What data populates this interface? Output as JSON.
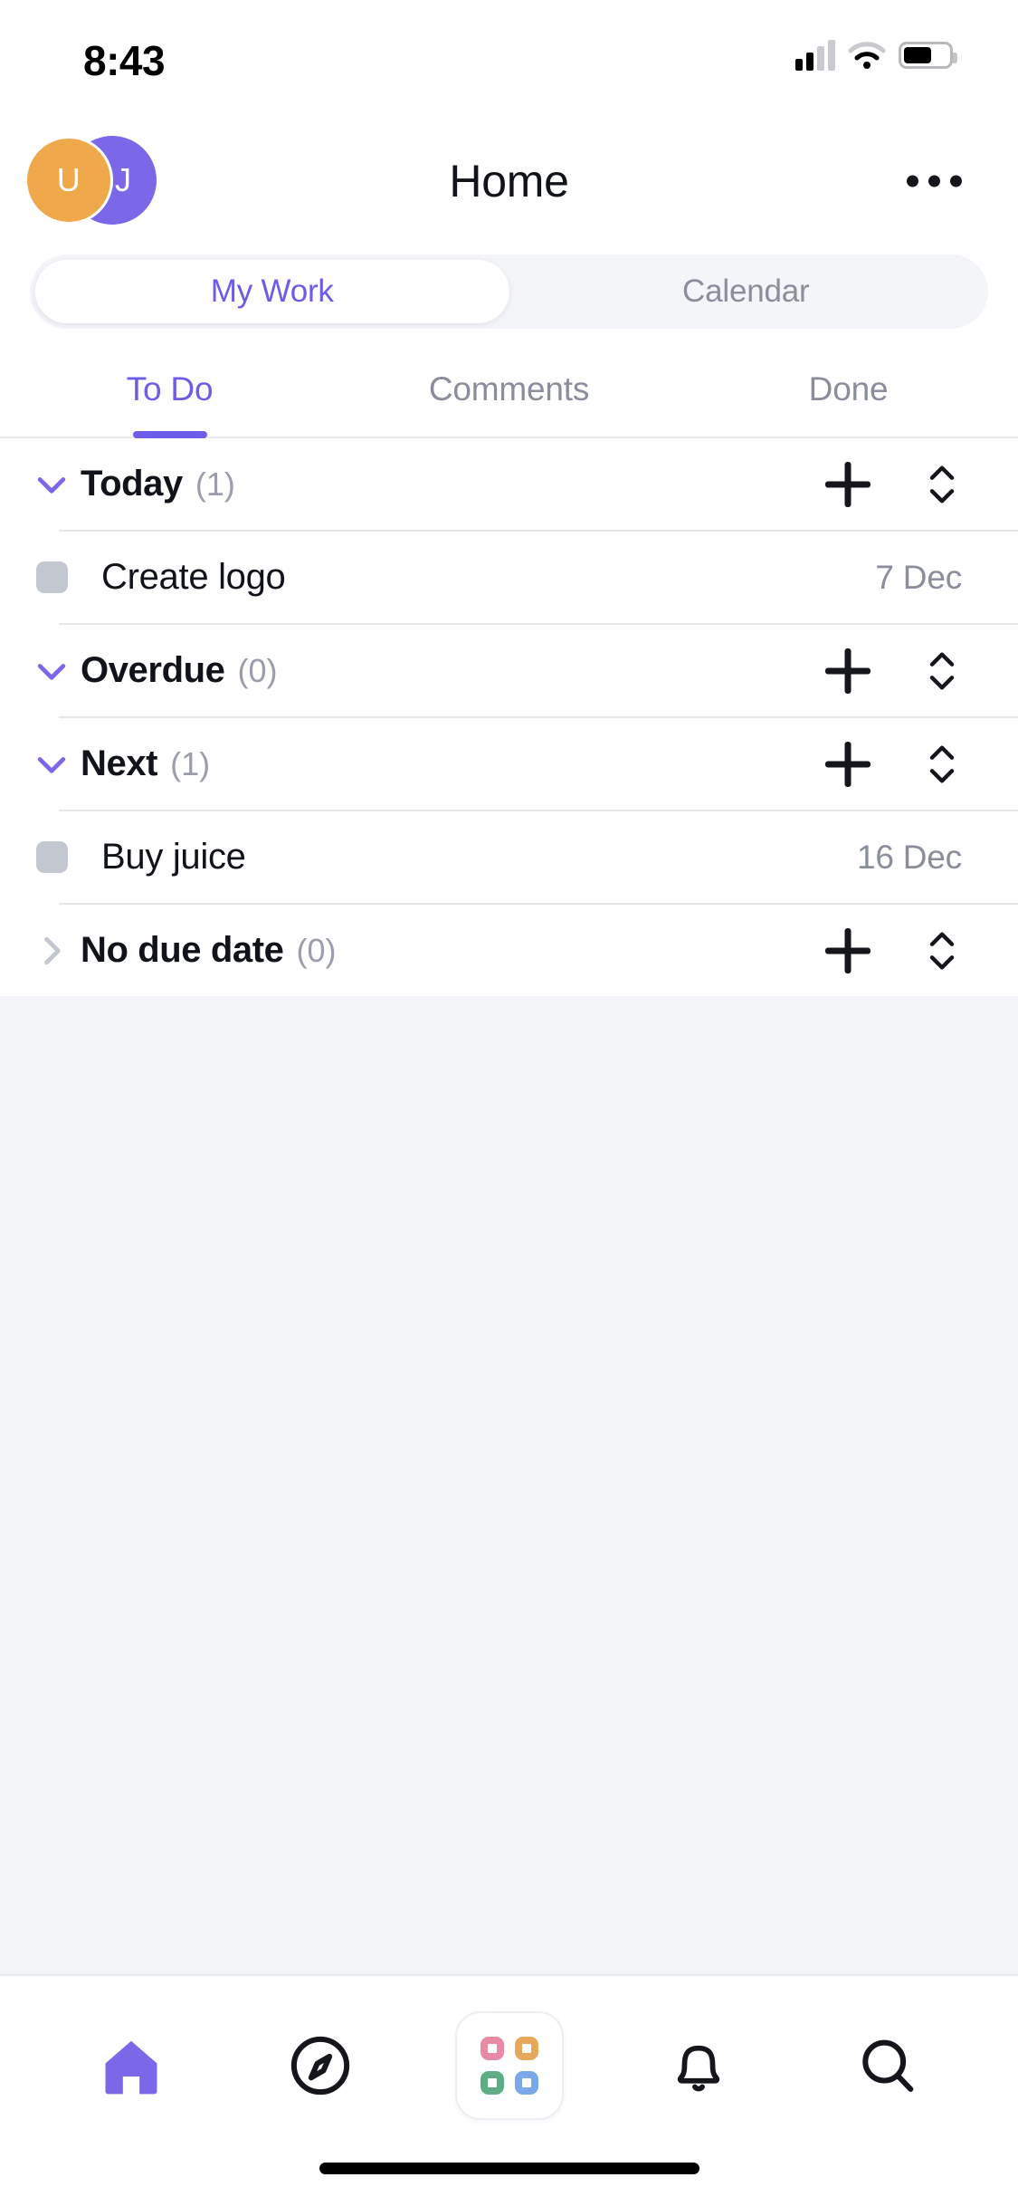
{
  "status_bar": {
    "time": "8:43",
    "signal_icon": "cellular-signal-icon",
    "wifi_icon": "wifi-icon",
    "battery_icon": "battery-icon"
  },
  "header": {
    "title": "Home",
    "avatars": [
      {
        "initials": "SJ",
        "color": "#7b68e8",
        "name": "avatar-secondary"
      },
      {
        "initials": "U",
        "color": "#efa84a",
        "name": "avatar-primary"
      }
    ],
    "more_icon": "more-horizontal-icon"
  },
  "segmented": {
    "items": [
      {
        "label": "My Work",
        "active": true
      },
      {
        "label": "Calendar",
        "active": false
      }
    ],
    "active_color": "#6c5ce7",
    "inactive_color": "#8a8d9b"
  },
  "tabs": {
    "items": [
      {
        "label": "To Do",
        "active": true
      },
      {
        "label": "Comments",
        "active": false
      },
      {
        "label": "Done",
        "active": false
      }
    ]
  },
  "sections": [
    {
      "title": "Today",
      "count": "(1)",
      "expanded": true,
      "chevron_icon": "chevron-down-icon",
      "add_icon": "plus-icon",
      "sort_icon": "sort-updown-icon",
      "tasks": [
        {
          "name": "Create logo",
          "date": "7 Dec",
          "checkbox_icon": "checkbox-unchecked-icon"
        }
      ]
    },
    {
      "title": "Overdue",
      "count": "(0)",
      "expanded": true,
      "chevron_icon": "chevron-down-icon",
      "add_icon": "plus-icon",
      "sort_icon": "sort-updown-icon",
      "tasks": []
    },
    {
      "title": "Next",
      "count": "(1)",
      "expanded": true,
      "chevron_icon": "chevron-down-icon",
      "add_icon": "plus-icon",
      "sort_icon": "sort-updown-icon",
      "tasks": [
        {
          "name": "Buy juice",
          "date": "16 Dec",
          "checkbox_icon": "checkbox-unchecked-icon"
        }
      ]
    },
    {
      "title": "No due date",
      "count": "(0)",
      "expanded": false,
      "chevron_icon": "chevron-right-icon",
      "add_icon": "plus-icon",
      "sort_icon": "sort-updown-icon",
      "tasks": []
    }
  ],
  "bottom_nav": {
    "items": [
      {
        "icon": "home-icon",
        "active": true
      },
      {
        "icon": "compass-icon",
        "active": false
      },
      {
        "icon": "apps-grid-icon",
        "active": false
      },
      {
        "icon": "bell-icon",
        "active": false
      },
      {
        "icon": "search-icon",
        "active": false
      }
    ],
    "apps_colors": [
      "#e88aa4",
      "#e8a85c",
      "#5fad84",
      "#7aa8e8"
    ],
    "active_color": "#7b68e8"
  }
}
